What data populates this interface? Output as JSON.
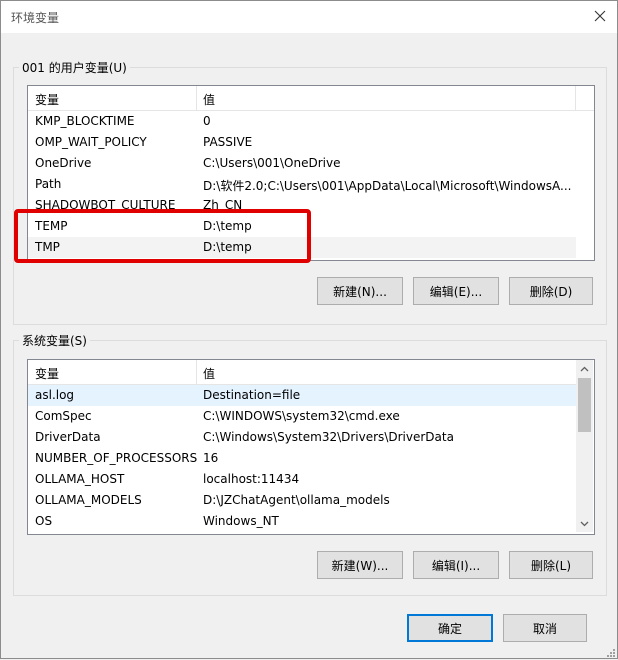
{
  "window": {
    "title": "环境变量"
  },
  "user_group": {
    "title": "001 的用户变量(U)",
    "headers": {
      "name": "变量",
      "value": "值"
    },
    "rows": [
      {
        "name": "KMP_BLOCKTIME",
        "value": "0"
      },
      {
        "name": "OMP_WAIT_POLICY",
        "value": "PASSIVE"
      },
      {
        "name": "OneDrive",
        "value": "C:\\Users\\001\\OneDrive"
      },
      {
        "name": "Path",
        "value": "D:\\软件2.0;C:\\Users\\001\\AppData\\Local\\Microsoft\\WindowsA..."
      },
      {
        "name": "SHADOWBOT_CULTURE",
        "value": "Zh_CN"
      },
      {
        "name": "TEMP",
        "value": "D:\\temp"
      },
      {
        "name": "TMP",
        "value": "D:\\temp"
      }
    ],
    "buttons": {
      "new": "新建(N)...",
      "edit": "编辑(E)...",
      "delete": "删除(D)"
    }
  },
  "system_group": {
    "title": "系统变量(S)",
    "headers": {
      "name": "变量",
      "value": "值"
    },
    "rows": [
      {
        "name": "asl.log",
        "value": "Destination=file"
      },
      {
        "name": "ComSpec",
        "value": "C:\\WINDOWS\\system32\\cmd.exe"
      },
      {
        "name": "DriverData",
        "value": "C:\\Windows\\System32\\Drivers\\DriverData"
      },
      {
        "name": "NUMBER_OF_PROCESSORS",
        "value": "16"
      },
      {
        "name": "OLLAMA_HOST",
        "value": "localhost:11434"
      },
      {
        "name": "OLLAMA_MODELS",
        "value": "D:\\JZChatAgent\\ollama_models"
      },
      {
        "name": "OS",
        "value": "Windows_NT"
      }
    ],
    "buttons": {
      "new": "新建(W)...",
      "edit": "编辑(I)...",
      "delete": "删除(L)"
    }
  },
  "footer": {
    "ok": "确定",
    "cancel": "取消"
  },
  "colors": {
    "highlight_box": "#e10000",
    "selected_row": "#e5f3ff"
  }
}
